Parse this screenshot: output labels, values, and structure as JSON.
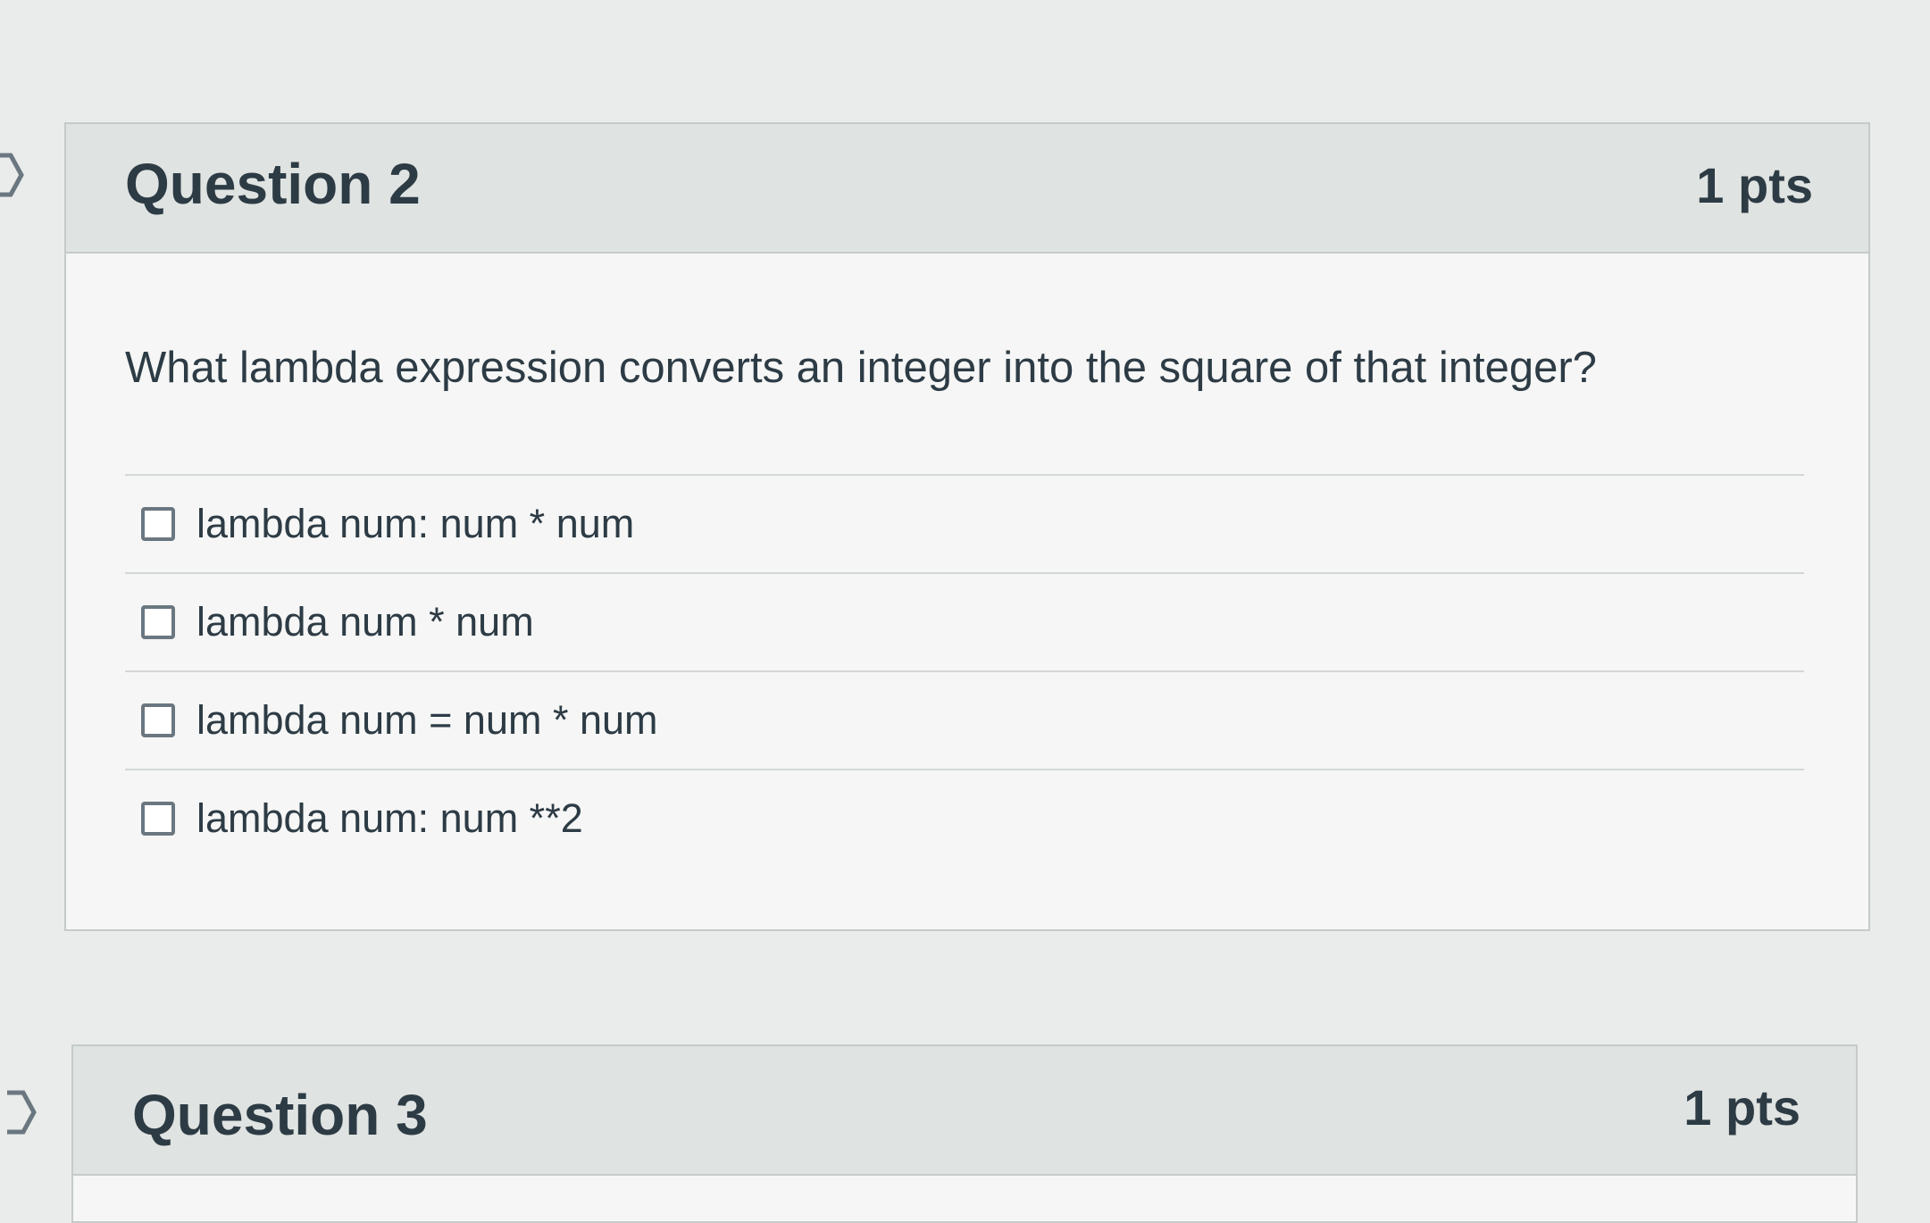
{
  "question2": {
    "title": "Question 2",
    "points": "1 pts",
    "text": "What lambda expression converts an integer into the square of that integer?",
    "answers": [
      {
        "label": "lambda num: num * num",
        "checked": false
      },
      {
        "label": "lambda num * num",
        "checked": false
      },
      {
        "label": "lambda num = num * num",
        "checked": false
      },
      {
        "label": "lambda num: num **2",
        "checked": false
      }
    ]
  },
  "question3": {
    "title": "Question 3",
    "points": "1 pts"
  },
  "icons": {
    "flag": "flag-icon"
  },
  "colors": {
    "header_bg": "#dfe3e1",
    "card_bg": "#f5f6f5",
    "text": "#2d3b45",
    "border": "#c5cbc9"
  }
}
